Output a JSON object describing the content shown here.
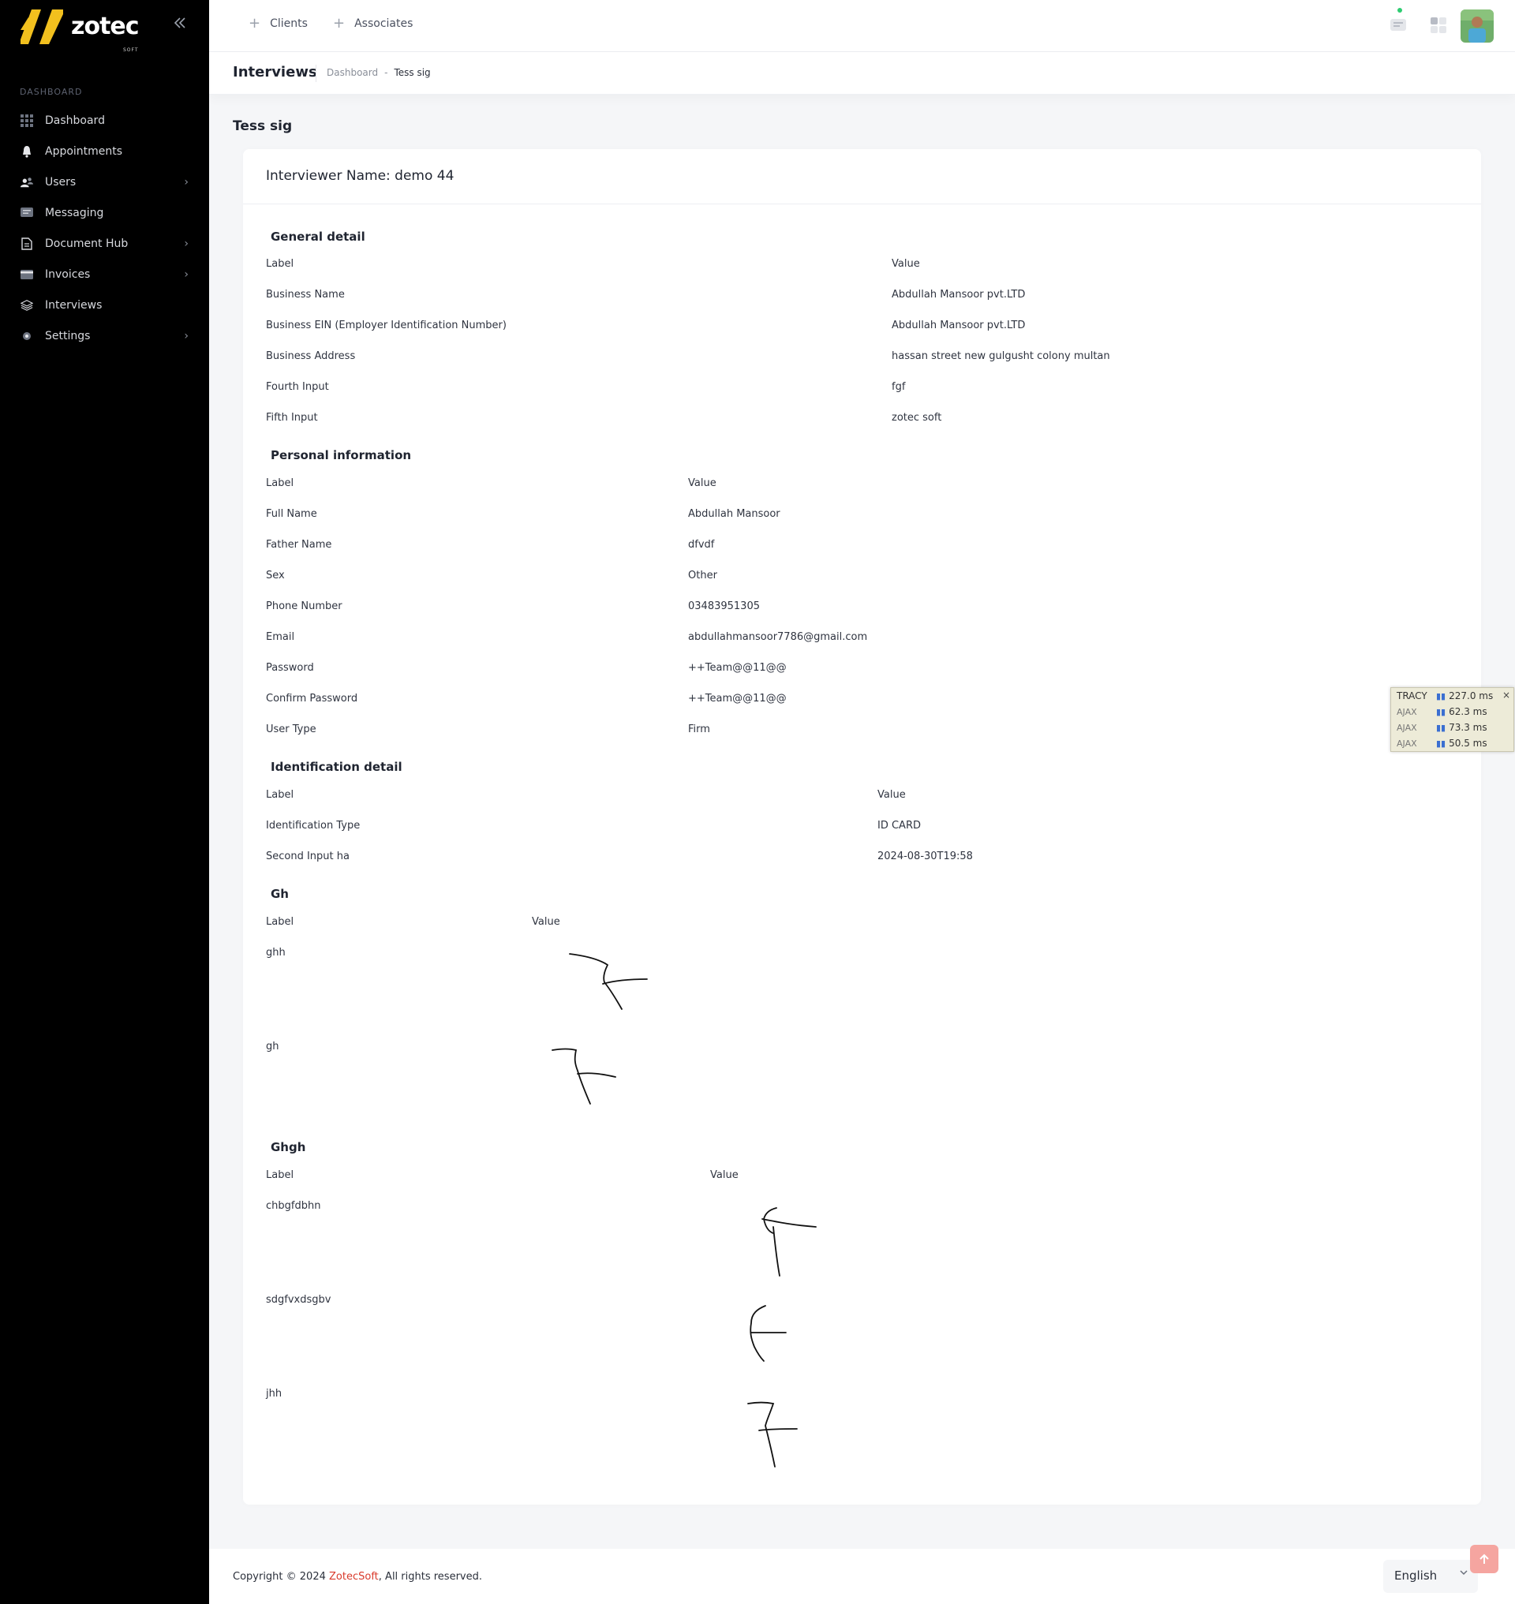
{
  "brand": {
    "name": "zotec",
    "sub": "SOFT",
    "accent": "#f2c01e"
  },
  "sidebar": {
    "section_label": "DASHBOARD",
    "items": [
      {
        "label": "Dashboard",
        "icon": "grid-icon",
        "has_chevron": false
      },
      {
        "label": "Appointments",
        "icon": "bell-icon",
        "has_chevron": false
      },
      {
        "label": "Users",
        "icon": "users-icon",
        "has_chevron": true
      },
      {
        "label": "Messaging",
        "icon": "message-icon",
        "has_chevron": false
      },
      {
        "label": "Document Hub",
        "icon": "document-icon",
        "has_chevron": true
      },
      {
        "label": "Invoices",
        "icon": "card-icon",
        "has_chevron": true
      },
      {
        "label": "Interviews",
        "icon": "layers-icon",
        "has_chevron": false
      },
      {
        "label": "Settings",
        "icon": "gear-icon",
        "has_chevron": true
      }
    ]
  },
  "header": {
    "links": [
      {
        "label": "Clients"
      },
      {
        "label": "Associates"
      }
    ]
  },
  "toolbar": {
    "title": "Interviews",
    "breadcrumb": {
      "home": "Dashboard",
      "separator": "-",
      "current": "Tess sig"
    }
  },
  "content": {
    "title": "Tess sig",
    "card_title": "Interviewer Name: demo 44",
    "sections": [
      {
        "title": "General detail",
        "header": {
          "label": "Label",
          "value": "Value"
        },
        "rows": [
          {
            "label": "Business Name",
            "value": "Abdullah Mansoor pvt.LTD"
          },
          {
            "label": "Business EIN (Employer Identification Number)",
            "value": "Abdullah Mansoor pvt.LTD"
          },
          {
            "label": "Business Address",
            "value": "hassan street new gulgusht colony multan"
          },
          {
            "label": "Fourth Input",
            "value": "fgf"
          },
          {
            "label": "Fifth Input",
            "value": "zotec soft"
          }
        ]
      },
      {
        "title": "Personal information",
        "header": {
          "label": "Label",
          "value": "Value"
        },
        "rows": [
          {
            "label": "Full Name",
            "value": "Abdullah Mansoor"
          },
          {
            "label": "Father Name",
            "value": "dfvdf"
          },
          {
            "label": "Sex",
            "value": "Other"
          },
          {
            "label": "Phone Number",
            "value": "03483951305"
          },
          {
            "label": "Email",
            "value": "abdullahmansoor7786@gmail.com"
          },
          {
            "label": "Password",
            "value": "++Team@@11@@"
          },
          {
            "label": "Confirm Password",
            "value": "++Team@@11@@"
          },
          {
            "label": "User Type",
            "value": "Firm"
          }
        ]
      },
      {
        "title": "Identification detail",
        "header": {
          "label": "Label",
          "value": "Value"
        },
        "rows": [
          {
            "label": "Identification Type",
            "value": "ID CARD"
          },
          {
            "label": "Second Input ha",
            "value": "2024-08-30T19:58"
          }
        ]
      },
      {
        "title": "Gh",
        "header": {
          "label": "Label",
          "value": "Value"
        },
        "rows": [
          {
            "label": "ghh"
          },
          {
            "label": "gh"
          }
        ]
      },
      {
        "title": "Ghgh",
        "header": {
          "label": "Label",
          "value": "Value"
        },
        "rows": [
          {
            "label": "chbgfdbhn"
          },
          {
            "label": "sdgfvxdsgbv"
          },
          {
            "label": "jhh"
          }
        ]
      }
    ]
  },
  "tracy": {
    "title": "TRACY",
    "total": "227.0 ms",
    "ajax": [
      {
        "label": "AJAX",
        "time": "62.3 ms"
      },
      {
        "label": "AJAX",
        "time": "73.3 ms"
      },
      {
        "label": "AJAX",
        "time": "50.5 ms"
      }
    ],
    "close": "×"
  },
  "footer": {
    "copyright_prefix": "Copyright © 2024 ",
    "company": "ZotecSoft",
    "copyright_suffix": ", All rights reserved.",
    "language": "English"
  },
  "colors": {
    "sidebar_bg": "#000000",
    "brand_red": "#d93a2b",
    "scroll_top_bg": "#f5a5a0",
    "notification_dot": "#2ecc71"
  }
}
